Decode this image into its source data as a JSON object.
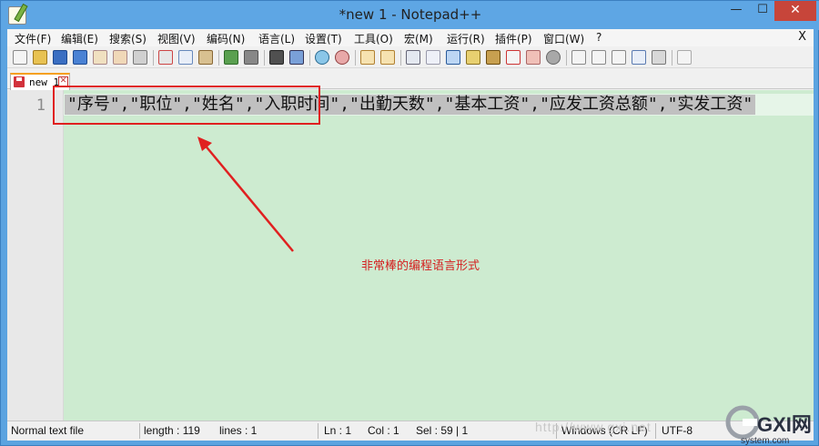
{
  "window": {
    "title": "*new 1 - Notepad++",
    "minimize_glyph": "—",
    "maximize_glyph": "☐",
    "close_glyph": "✕"
  },
  "menu": {
    "items": [
      "文件(F)",
      "编辑(E)",
      "搜索(S)",
      "视图(V)",
      "编码(N)",
      "语言(L)",
      "设置(T)",
      "工具(O)",
      "宏(M)",
      "运行(R)",
      "插件(P)",
      "窗口(W)",
      "?"
    ],
    "close_label": "X"
  },
  "toolbar": {
    "icons": [
      "new-file-icon",
      "open-file-icon",
      "save-icon",
      "save-all-icon",
      "close-icon",
      "close-all-icon",
      "print-icon",
      "cut-icon",
      "copy-icon",
      "paste-icon",
      "undo-icon",
      "redo-icon",
      "find-icon",
      "replace-icon",
      "zoom-in-icon",
      "zoom-out-icon",
      "sync-vertical-icon",
      "sync-horizontal-icon",
      "word-wrap-icon",
      "show-all-characters-icon",
      "indent-guide-icon",
      "document-map-icon",
      "function-list-icon",
      "folder-workspace-icon",
      "monitoring-icon",
      "record-macro-icon",
      "stop-macro-icon",
      "play-macro-icon",
      "run-macro-multiple-icon",
      "save-macro-icon",
      "spell-check-icon"
    ]
  },
  "tabs": [
    {
      "label": "new 1",
      "modified": true
    }
  ],
  "editor": {
    "line_number": "1",
    "line_text": "\"序号\",\"职位\",\"姓名\",\"入职时间\",\"出勤天数\",\"基本工资\",\"应发工资总额\",\"实发工资\"",
    "background_color": "#cdebd0",
    "selection_color": "#c0c0c0"
  },
  "statusbar": {
    "file_type": "Normal text file",
    "length": "length : 119",
    "lines": "lines : 1",
    "ln": "Ln : 1",
    "col": "Col : 1",
    "sel": "Sel : 59 | 1",
    "eol": "Windows (CR LF)",
    "encoding": "UTF-8"
  },
  "annotation": {
    "text": "非常棒的编程语言形式",
    "color": "#e02020"
  },
  "watermark": {
    "url_text": "http://www.gxi.net",
    "logo_text": "GXI网",
    "logo_subtext": "system.com"
  }
}
